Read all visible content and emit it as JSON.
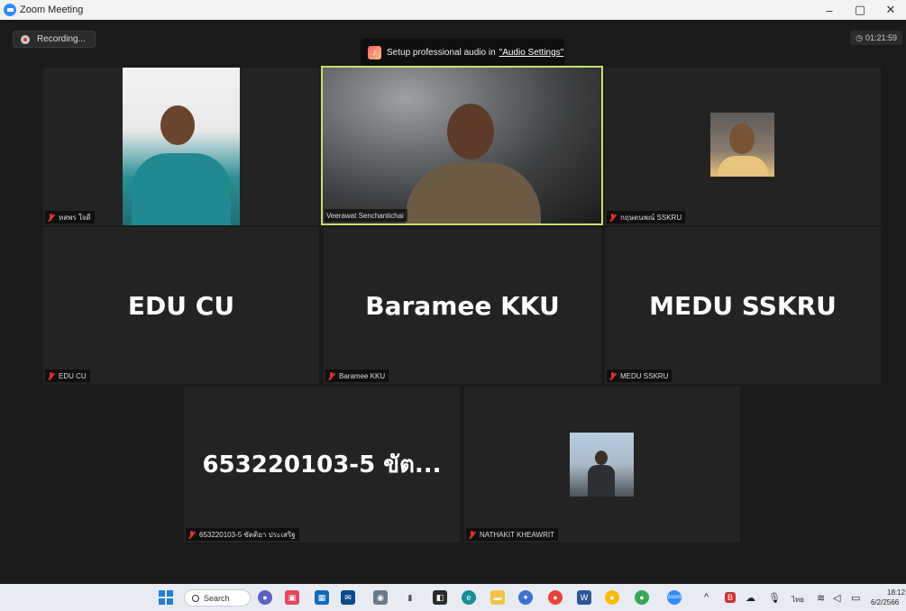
{
  "window": {
    "title": "Zoom Meeting",
    "controls": {
      "minimize": "–",
      "restore": "▢",
      "close": "✕"
    }
  },
  "meeting": {
    "recording_label": "Recording...",
    "timer": "01:21:59",
    "banner": {
      "text": "Setup professional audio in",
      "link": "\"Audio Settings\""
    }
  },
  "tiles": [
    {
      "name": "หสพร ใจดี",
      "type": "video",
      "muted": true
    },
    {
      "name": "Veerawat Senchantichai",
      "type": "video",
      "active": true,
      "muted": false
    },
    {
      "name": "กฤษดนพณ์ SSKRU",
      "type": "video",
      "muted": true
    },
    {
      "name": "EDU CU",
      "big_name": "EDU CU",
      "type": "name",
      "muted": true
    },
    {
      "name": "Baramee KKU",
      "big_name": "Baramee KKU",
      "type": "name",
      "muted": true
    },
    {
      "name": "MEDU SSKRU",
      "big_name": "MEDU SSKRU",
      "type": "name",
      "muted": true
    },
    {
      "name": "653220103-5 ขัตติยา ประเสริฐ",
      "big_name": "653220103-5 ขัต...",
      "type": "name",
      "muted": true
    },
    {
      "name": "NATHAKIT KHEAWRIT",
      "type": "video",
      "muted": true
    }
  ],
  "taskbar": {
    "search_label": "Search",
    "icons": [
      "windows-start-icon",
      "search-icon",
      "chat-icon",
      "store-icon",
      "calendar-icon",
      "mail-icon",
      "camera-icon",
      "usb-icon",
      "sticky-notes-icon",
      "edge-icon",
      "file-explorer-icon",
      "app-icon",
      "chrome-icon",
      "word-icon",
      "chrome-alt-icon",
      "chrome-profile-icon",
      "zoom-icon"
    ],
    "tray": {
      "lang": "ไทย",
      "time": "18:12",
      "date": "6/2/2566"
    }
  },
  "colors": {
    "active_border": "#c7e06a",
    "muted_icon": "#e2312f",
    "zoom_blue": "#2d8cff"
  }
}
